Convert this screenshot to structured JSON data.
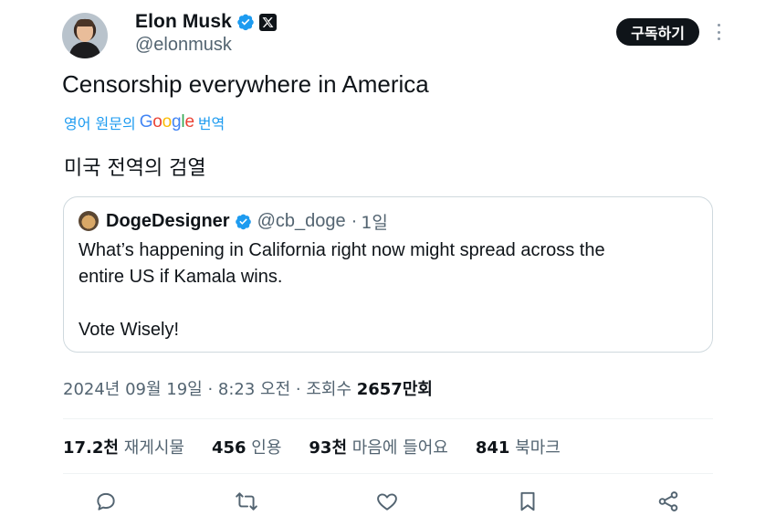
{
  "author": {
    "display_name": "Elon Musk",
    "handle": "@elonmusk",
    "verified_icon": "verified-badge-icon",
    "affiliation_icon": "x-logo-icon",
    "subscribe_label": "구독하기"
  },
  "tweet": {
    "text": "Censorship everywhere in America",
    "translate_prefix": "영어 원문의",
    "translate_brand": "Google",
    "translate_suffix": "번역",
    "translated_text": "미국 전역의 검열"
  },
  "quote": {
    "display_name": "DogeDesigner",
    "handle": "@cb_doge",
    "separator": "·",
    "time": "1일",
    "lines": [
      "What’s happening in California right now might spread across the",
      "entire US if Kamala wins.",
      "Vote Wisely!"
    ]
  },
  "meta": {
    "timestamp": "2024년 09월 19일 · 8:23 오전 · 조회수 ",
    "views": "2657만회"
  },
  "stats": [
    {
      "count": "17.2천",
      "label": "재게시물"
    },
    {
      "count": "456",
      "label": "인용"
    },
    {
      "count": "93천",
      "label": "마음에 들어요"
    },
    {
      "count": "841",
      "label": "북마크"
    }
  ],
  "actions": [
    "reply-icon",
    "repost-icon",
    "like-icon",
    "bookmark-icon",
    "share-icon"
  ],
  "colors": {
    "link": "#1d9bf0",
    "verified": "#1d9bf0",
    "muted": "#536471",
    "text": "#0f1419"
  }
}
